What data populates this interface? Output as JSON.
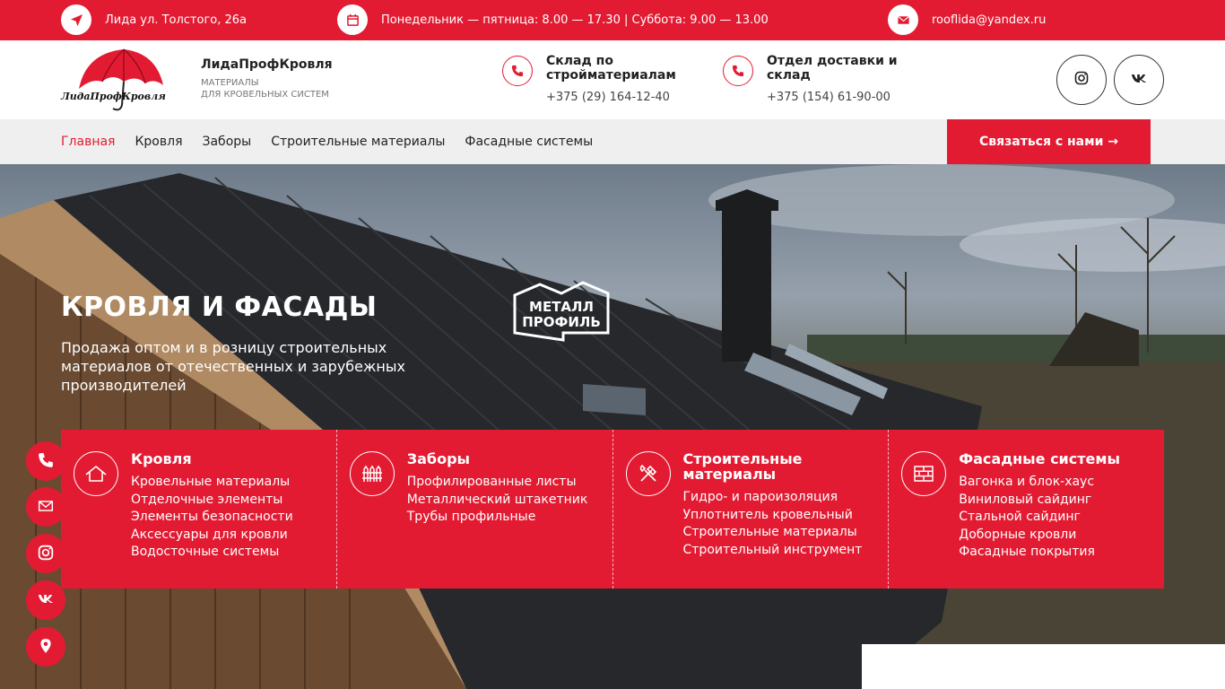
{
  "topbar": {
    "address": "Лида ул. Толстого, 26а",
    "hours": "Понедельник — пятница: 8.00 — 17.30 | Суббота: 9.00 — 13.00",
    "email": "rooflida@yandex.ru"
  },
  "brand": {
    "logo_text": "ЛидаПрофКровля",
    "name": "ЛидаПрофКровля",
    "tagline_1": "материалы",
    "tagline_2": "для кровельных систем"
  },
  "contacts": [
    {
      "title": "Склад по стройматериалам",
      "phone": "+375 (29) 164-12-40"
    },
    {
      "title": "Отдел доставки и склад",
      "phone": "+375 (154) 61-90-00"
    }
  ],
  "nav": {
    "items": [
      "Главная",
      "Кровля",
      "Заборы",
      "Строительные материалы",
      "Фасадные системы"
    ],
    "cta": "Связаться с нами →"
  },
  "hero": {
    "title": "КРОВЛЯ И ФАСАДЫ",
    "subtitle": "Продажа оптом и в розницу строительных материалов от отечественных и зарубежных производителей",
    "partner_logo_line1": "МЕТАЛЛ",
    "partner_logo_line2": "ПРОФИЛЬ"
  },
  "categories": [
    {
      "title": "Кровля",
      "items": [
        "Кровельные материалы",
        "Отделочные элементы",
        "Элементы безопасности",
        "Аксессуары для кровли",
        "Водосточные системы"
      ]
    },
    {
      "title": "Заборы",
      "items": [
        "Профилированные листы",
        "Металлический штакетник",
        "Трубы профильные"
      ]
    },
    {
      "title": "Строительные материалы",
      "items": [
        "Гидро- и пароизоляция",
        "Уплотнитель кровельный",
        "Строительные материалы",
        "Строительный инструмент"
      ]
    },
    {
      "title": "Фасадные системы",
      "items": [
        "Вагонка и блок-хаус",
        "Виниловый сайдинг",
        "Стальной сайдинг",
        "Доборные кровли",
        "Фасадные покрытия"
      ]
    }
  ],
  "icons": [
    "location-arrow-icon",
    "calendar-icon",
    "envelope-icon",
    "phone-icon",
    "instagram-icon",
    "vk-icon",
    "map-pin-icon"
  ],
  "colors": {
    "accent": "#e31b32",
    "nav_bg": "#efefef"
  }
}
